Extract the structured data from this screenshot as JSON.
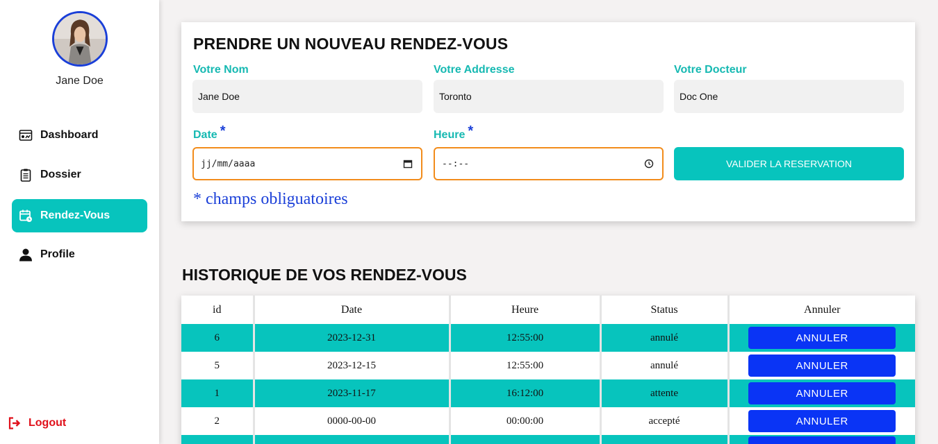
{
  "sidebar": {
    "user_name": "Jane Doe",
    "items": [
      {
        "label": "Dashboard",
        "icon": "dashboard-icon"
      },
      {
        "label": "Dossier",
        "icon": "clipboard-icon"
      },
      {
        "label": "Rendez-Vous",
        "icon": "calendar-icon",
        "active": true
      },
      {
        "label": "Profile",
        "icon": "user-icon"
      }
    ],
    "logout_label": "Logout"
  },
  "form": {
    "title": "PRENDRE UN NOUVEAU RENDEZ-VOUS",
    "name_label": "Votre Nom",
    "name_value": "Jane Doe",
    "address_label": "Votre Addresse",
    "address_value": "Toronto",
    "doctor_label": "Votre Docteur",
    "doctor_value": "Doc One",
    "date_label": "Date",
    "date_placeholder": "jj/mm/aaaa",
    "time_label": "Heure",
    "time_placeholder": "--:--",
    "required_marker": "*",
    "submit_label": "VALIDER LA RESERVATION",
    "required_note": "* champs obliguatoires"
  },
  "history": {
    "title": "HISTORIQUE DE VOS RENDEZ-VOUS",
    "columns": [
      "id",
      "Date",
      "Heure",
      "Status",
      "Annuler"
    ],
    "cancel_label": "ANNULER",
    "rows": [
      {
        "id": "6",
        "date": "2023-12-31",
        "time": "12:55:00",
        "status": "annulé"
      },
      {
        "id": "5",
        "date": "2023-12-15",
        "time": "12:55:00",
        "status": "annulé"
      },
      {
        "id": "1",
        "date": "2023-11-17",
        "time": "16:12:00",
        "status": "attente"
      },
      {
        "id": "2",
        "date": "0000-00-00",
        "time": "00:00:00",
        "status": "accepté"
      }
    ]
  },
  "colors": {
    "accent_teal": "#07c4bd",
    "cancel_blue": "#0a34f5",
    "logout_red": "#e0101a",
    "input_border_orange": "#f28c1b"
  }
}
